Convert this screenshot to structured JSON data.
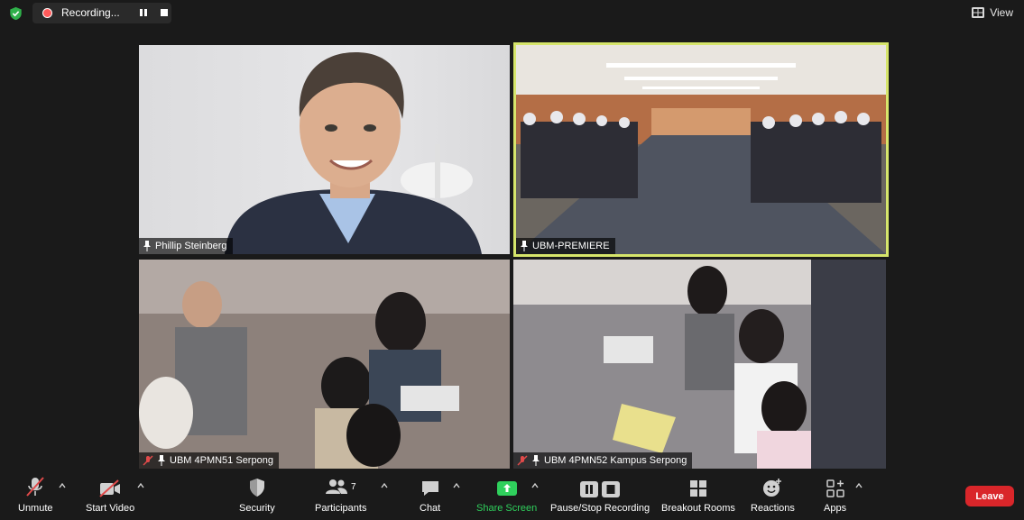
{
  "recording": {
    "label": "Recording..."
  },
  "view": {
    "label": "View"
  },
  "tiles": [
    {
      "name": "Phillip Steinberg"
    },
    {
      "name": "UBM-PREMIERE"
    },
    {
      "name": "UBM 4PMN51 Serpong"
    },
    {
      "name": "UBM 4PMN52 Kampus Serpong"
    }
  ],
  "toolbar": {
    "unmute": "Unmute",
    "start_video": "Start Video",
    "security": "Security",
    "participants": "Participants",
    "participants_count": "7",
    "chat": "Chat",
    "share_screen": "Share Screen",
    "pause_stop_recording": "Pause/Stop Recording",
    "breakout_rooms": "Breakout Rooms",
    "reactions": "Reactions",
    "apps": "Apps",
    "leave": "Leave"
  },
  "colors": {
    "active_speaker_border": "#d6e56b",
    "share_green": "#2fd05c",
    "leave_red": "#d9262a"
  }
}
